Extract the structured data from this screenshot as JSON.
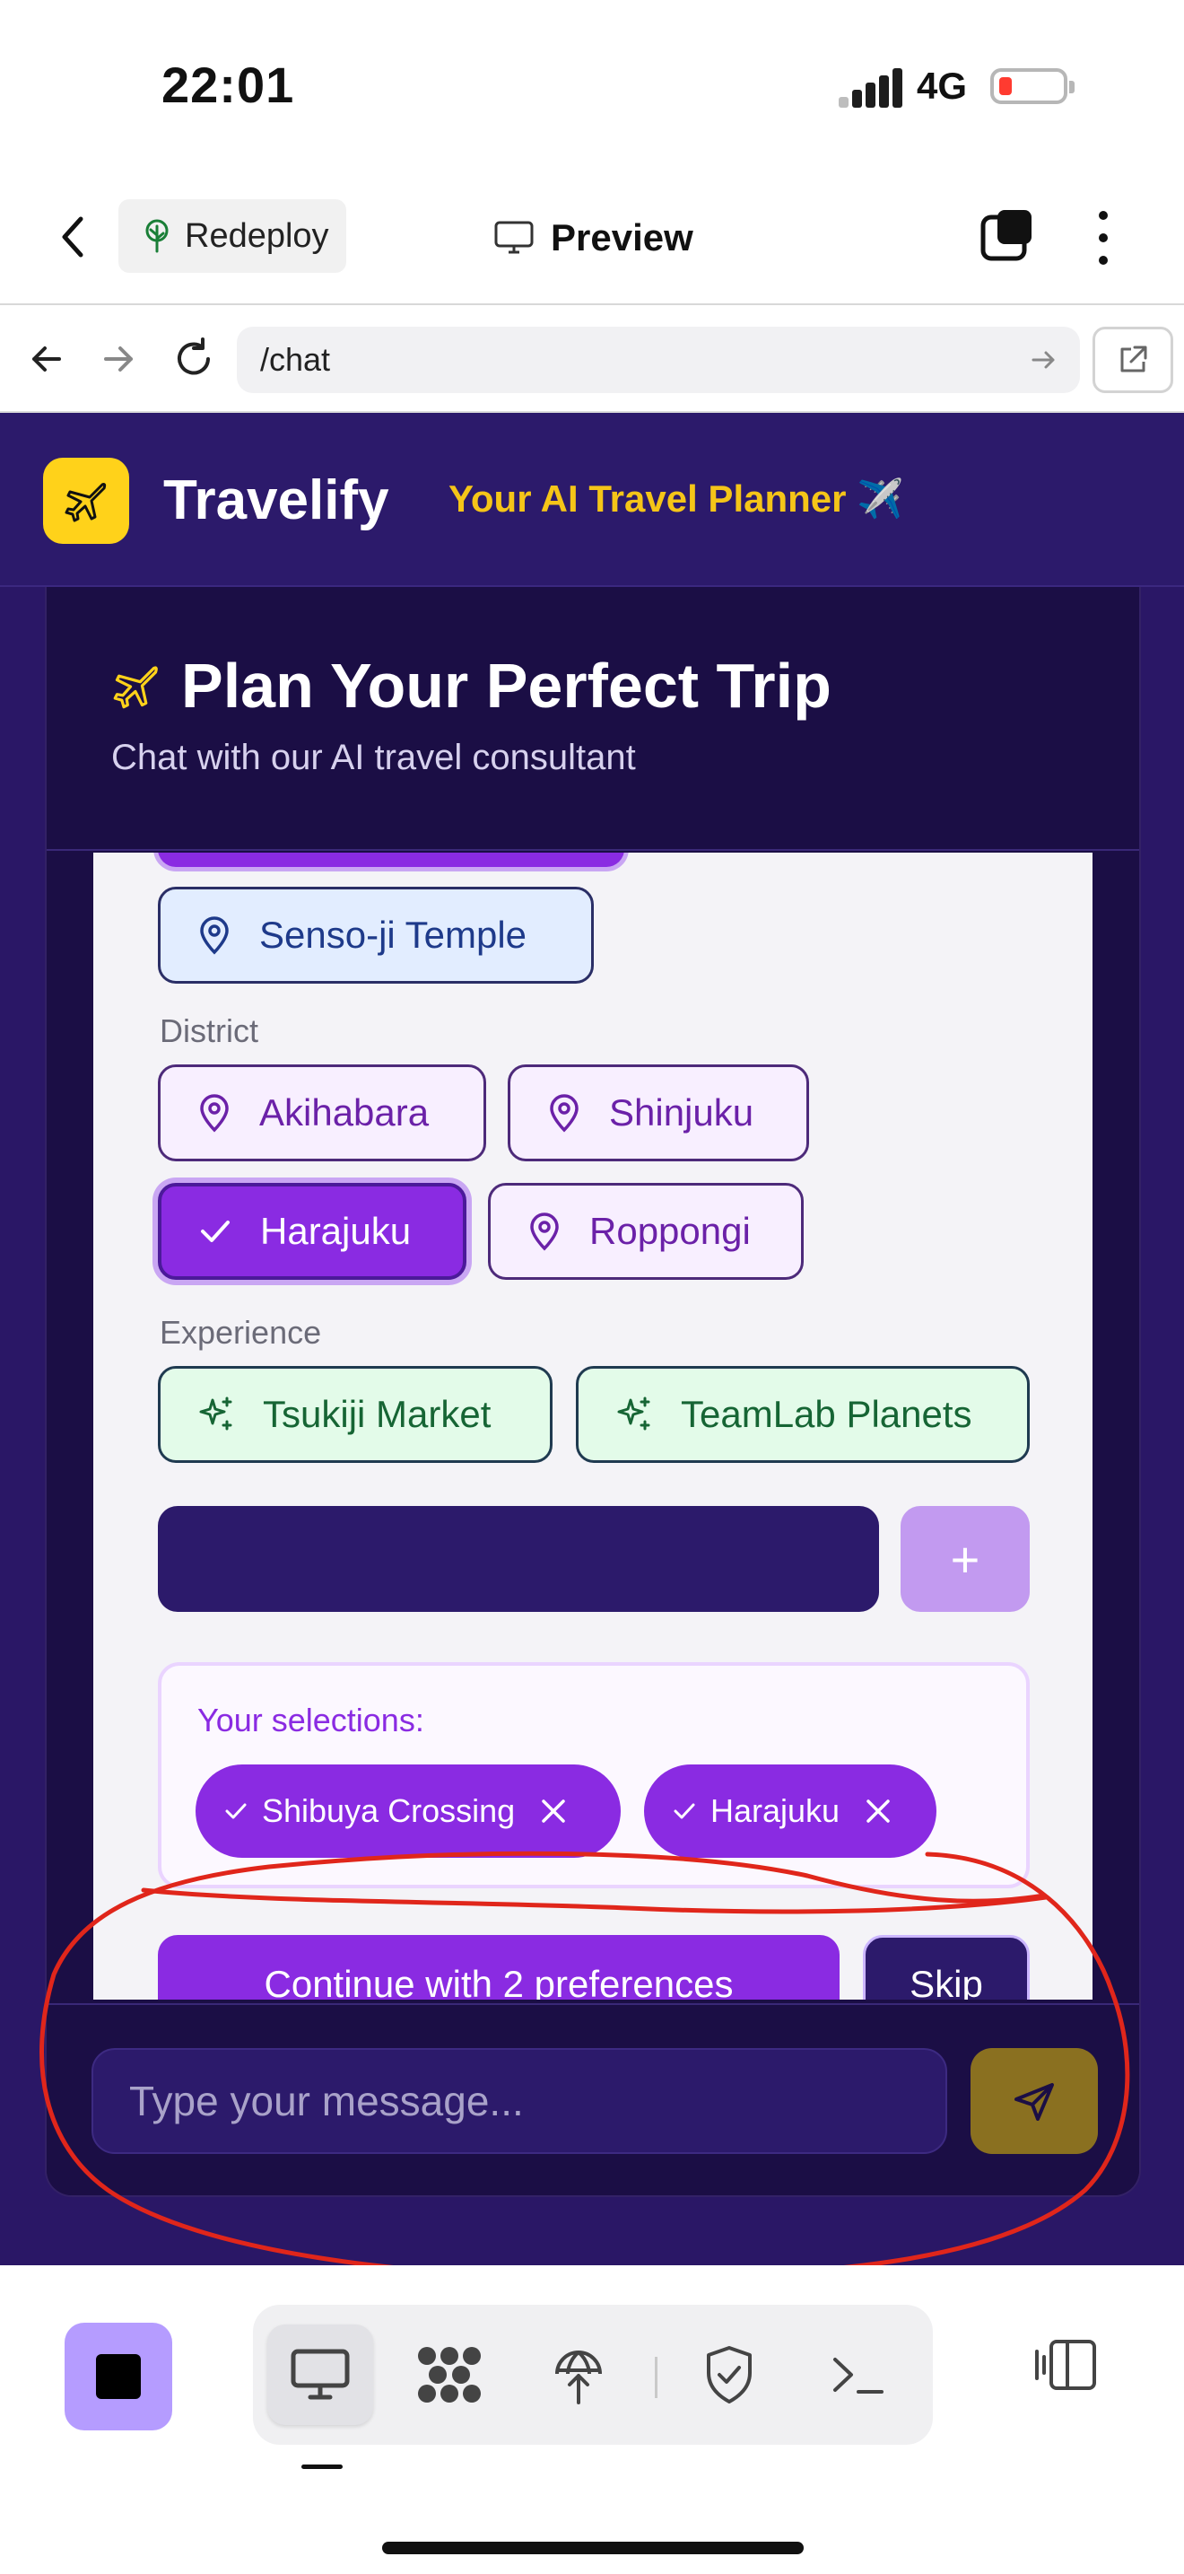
{
  "status_bar": {
    "time": "22:01",
    "network": "4G"
  },
  "app_toolbar": {
    "redeploy_label": "Redeploy",
    "preview_label": "Preview"
  },
  "browser": {
    "url": "/chat"
  },
  "app": {
    "name": "Travelify",
    "tagline": "Your AI Travel Planner ✈️"
  },
  "chat": {
    "title": "Plan Your Perfect Trip",
    "subtitle": "Chat with our AI travel consultant",
    "options": {
      "landmarks": [
        "Senso-ji Temple"
      ],
      "district_label": "District",
      "districts": [
        {
          "label": "Akihabara",
          "selected": false
        },
        {
          "label": "Shinjuku",
          "selected": false
        },
        {
          "label": "Harajuku",
          "selected": true
        },
        {
          "label": "Roppongi",
          "selected": false
        }
      ],
      "experience_label": "Experience",
      "experiences": [
        "Tsukiji Market",
        "TeamLab Planets"
      ]
    },
    "custom_input_value": "",
    "add_label": "+",
    "selections_label": "Your selections:",
    "selections": [
      "Shibuya Crossing",
      "Harajuku"
    ],
    "continue_label": "Continue with 2 preferences",
    "skip_label": "Skip",
    "message_placeholder": "Type your message..."
  },
  "colors": {
    "page_bg": "#2a1766",
    "accent_purple": "#8a2be2",
    "logo_yellow": "#ffd21a",
    "tagline_gold": "#f5c518",
    "send_button": "#8a7020",
    "annotation_red": "#e0261b"
  },
  "icons": {
    "logo": "airplane-icon",
    "landmark_chip": "map-pin-icon",
    "experience_chip": "sparkles-icon",
    "send": "send-icon"
  }
}
